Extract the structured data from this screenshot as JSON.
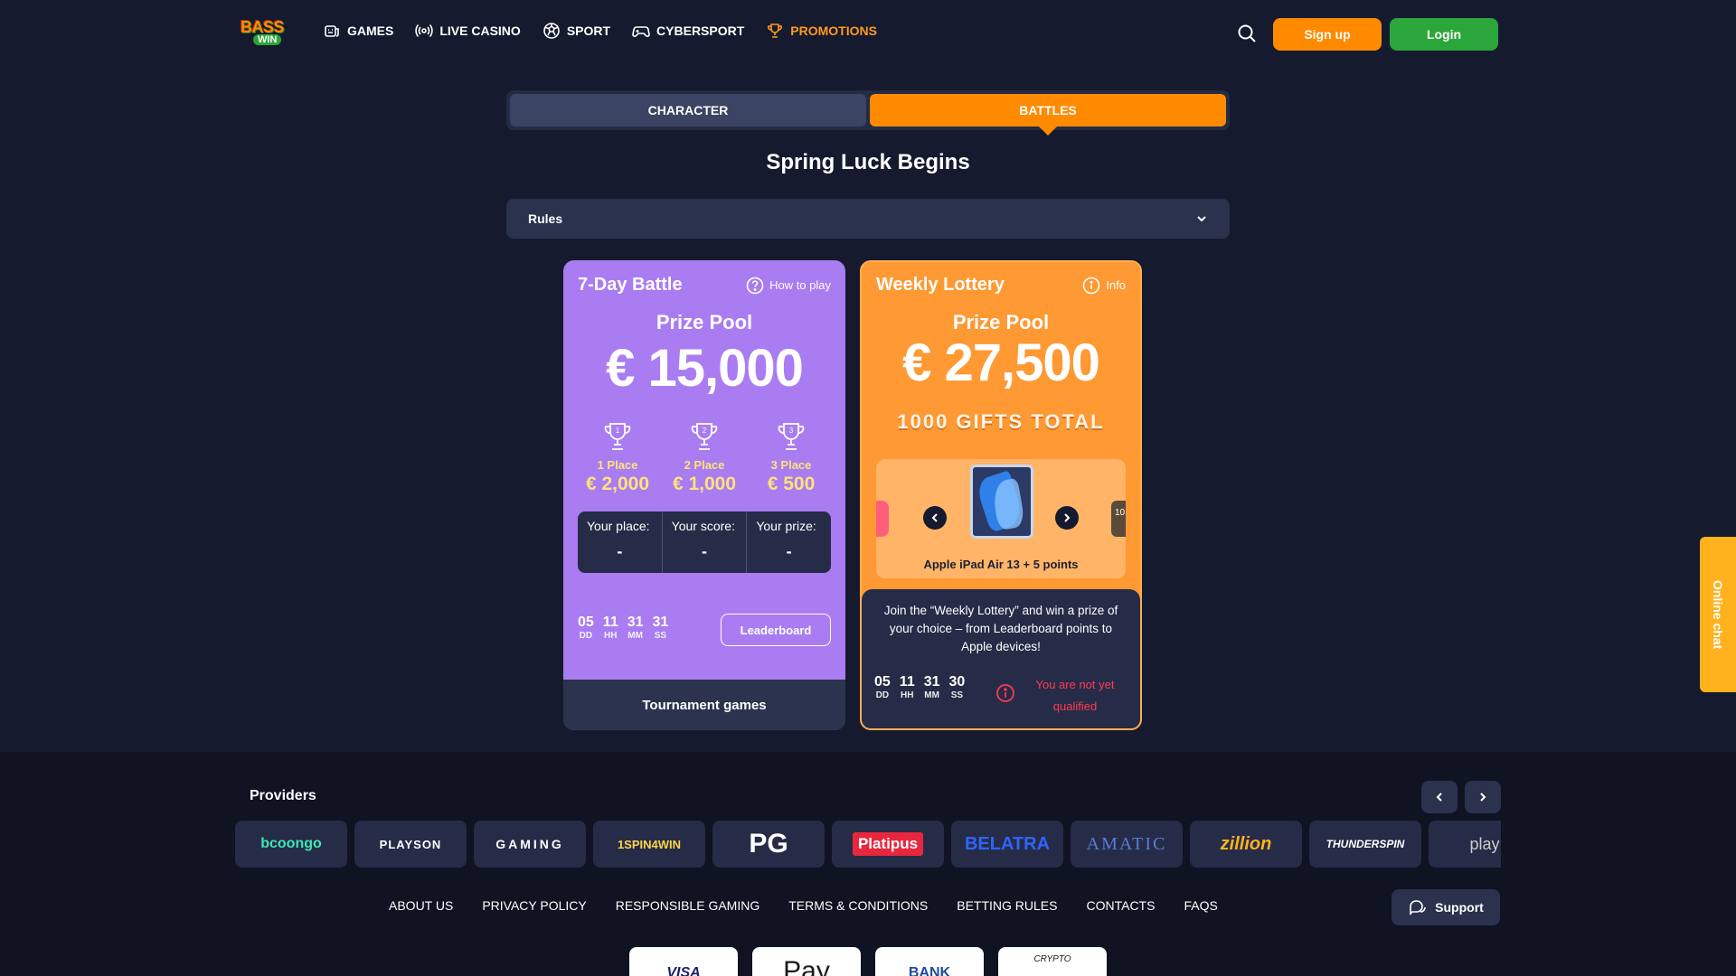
{
  "brand": {
    "logo_top": "BASS",
    "logo_bottom": "WIN"
  },
  "nav": [
    {
      "label": "GAMES",
      "icon": "games-icon"
    },
    {
      "label": "LIVE CASINO",
      "icon": "live-casino-icon"
    },
    {
      "label": "SPORT",
      "icon": "sport-ball-icon"
    },
    {
      "label": "CYBERSPORT",
      "icon": "gamepad-icon"
    },
    {
      "label": "PROMOTIONS",
      "icon": "trophy-icon",
      "active": true
    }
  ],
  "header": {
    "signup_label": "Sign up",
    "login_label": "Login"
  },
  "tabs": [
    {
      "label": "CHARACTER"
    },
    {
      "label": "BATTLES",
      "active": true
    }
  ],
  "page_title": "Spring Luck Begins",
  "rules_label": "Rules",
  "battle": {
    "title": "7-Day Battle",
    "how_to_play": "How to play",
    "prize_pool_label": "Prize Pool",
    "prize_pool_value": "€ 15,000",
    "places": [
      {
        "num": "1",
        "label": "1 Place",
        "prize": "€ 2,000"
      },
      {
        "num": "2",
        "label": "2 Place",
        "prize": "€ 1,000"
      },
      {
        "num": "3",
        "label": "3 Place",
        "prize": "€ 500"
      }
    ],
    "stats": [
      {
        "label": "Your place:",
        "value": "-"
      },
      {
        "label": "Your score:",
        "value": "-"
      },
      {
        "label": "Your prize:",
        "value": "-"
      }
    ],
    "timer": [
      {
        "num": "05",
        "unit": "DD"
      },
      {
        "num": "11",
        "unit": "HH"
      },
      {
        "num": "31",
        "unit": "MM"
      },
      {
        "num": "31",
        "unit": "SS"
      }
    ],
    "leaderboard_label": "Leaderboard",
    "tournament_games_label": "Tournament games"
  },
  "lottery": {
    "title": "Weekly Lottery",
    "info": "Info",
    "prize_pool_label": "Prize Pool",
    "prize_pool_value": "€ 27,500",
    "gifts_label": "1000 GIFTS TOTAL",
    "prize_name": "Apple iPad Air 13 + 5 points",
    "side_right_text": "10",
    "description": "Join the “Weekly Lottery” and win a prize of your choice – from Leaderboard points to Apple devices!",
    "timer": [
      {
        "num": "05",
        "unit": "DD"
      },
      {
        "num": "11",
        "unit": "HH"
      },
      {
        "num": "31",
        "unit": "MM"
      },
      {
        "num": "30",
        "unit": "SS"
      }
    ],
    "status": "You are not yet qualified"
  },
  "providers": {
    "title": "Providers",
    "items": [
      {
        "name": "bcoongo",
        "color": "#3ee6b4"
      },
      {
        "name": "PLAYSON",
        "color": "#ffffff"
      },
      {
        "name": "GAMING",
        "color": "#ffffff"
      },
      {
        "name": "1SPIN4WIN",
        "color": "#ffd54a"
      },
      {
        "name": "PG",
        "color": "#ffffff"
      },
      {
        "name": "Platipus",
        "color": "#ffffff"
      },
      {
        "name": "BELATRA",
        "color": "#2f64ff"
      },
      {
        "name": "AMATIC",
        "color": "#5a7bd9"
      },
      {
        "name": "zillion",
        "color": "#ffb21e"
      },
      {
        "name": "THUNDERSPIN",
        "color": "#ffffff"
      },
      {
        "name": "play",
        "color": "#cccccc"
      }
    ]
  },
  "footer_links": [
    "ABOUT US",
    "PRIVACY POLICY",
    "RESPONSIBLE GAMING",
    "TERMS & CONDITIONS",
    "BETTING RULES",
    "CONTACTS",
    "FAQS"
  ],
  "support_label": "Support",
  "payments": [
    "VISA",
    "Pay",
    "BANK",
    "CRYPTO"
  ],
  "online_chat_label": "Online chat",
  "colors": {
    "accent": "#ff8a00",
    "login": "#2ba63a",
    "battle_card": "#a97cf2",
    "lottery_card": "#ff9933",
    "bg": "#151a2e"
  }
}
